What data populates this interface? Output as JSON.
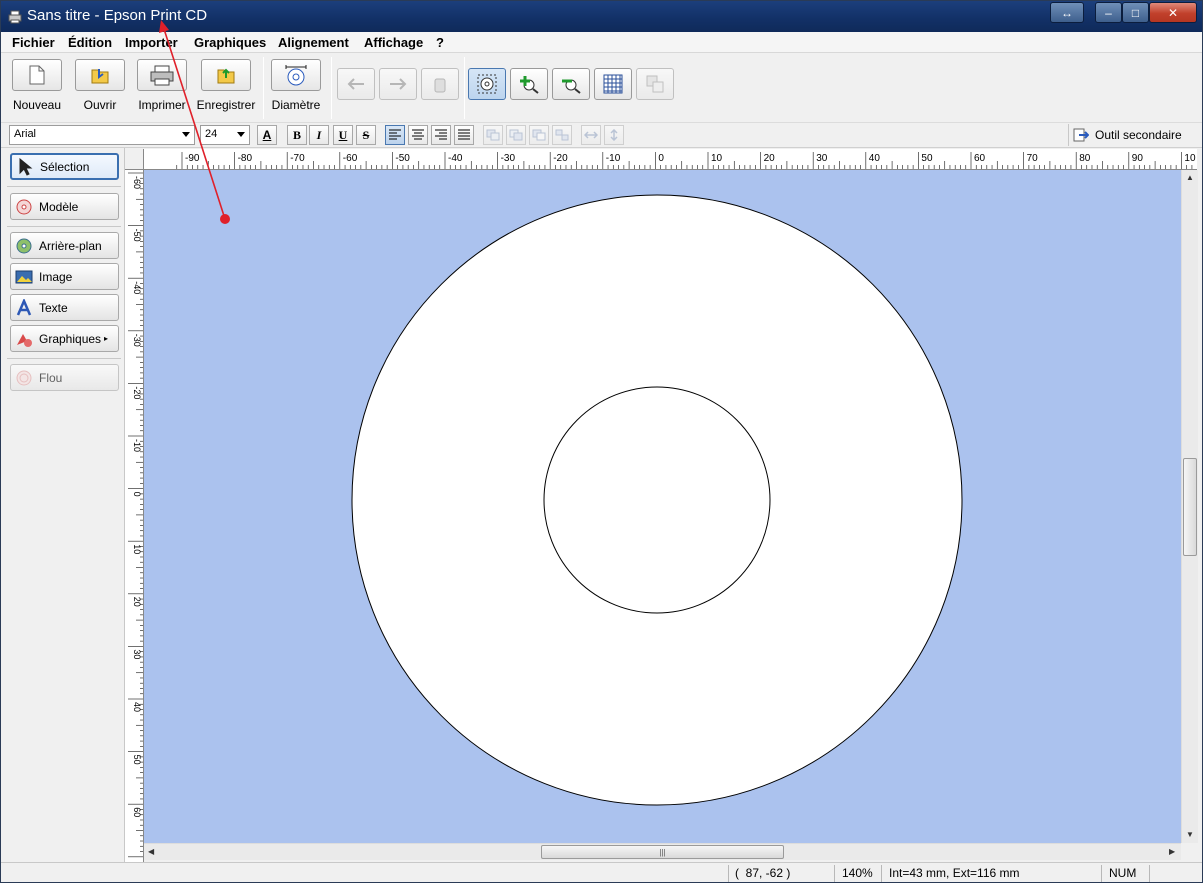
{
  "window": {
    "title": "Sans titre - Epson Print CD",
    "controls": {
      "restore_glyph": "↔",
      "minimize_glyph": "–",
      "maximize_glyph": "□",
      "close_glyph": "✕"
    }
  },
  "menu": {
    "items": [
      "Fichier",
      "Édition",
      "Importer",
      "Graphiques",
      "Alignement",
      "Affichage",
      "?"
    ]
  },
  "toolbar": {
    "new_label": "Nouveau",
    "open_label": "Ouvrir",
    "print_label": "Imprimer",
    "save_label": "Enregistrer",
    "diameter_label": "Diamètre"
  },
  "format": {
    "font": "Arial",
    "size": "24",
    "bold": "B",
    "italic": "I",
    "underline": "U",
    "strike": "S",
    "secondary_tool_label": "Outil secondaire"
  },
  "tools": {
    "selection": "Sélection",
    "model": "Modèle",
    "background": "Arrière-plan",
    "image": "Image",
    "text": "Texte",
    "graphics": "Graphiques",
    "blur": "Flou"
  },
  "ruler": {
    "h_labels": [
      "-90",
      "-80",
      "-70",
      "-60",
      "-50",
      "-40",
      "-30",
      "-20",
      "-10",
      "0",
      "10",
      "20",
      "30",
      "40",
      "50",
      "60",
      "70",
      "80",
      "90",
      "10"
    ],
    "v_labels": [
      "-60",
      "-50",
      "-40",
      "-30",
      "-20",
      "-10",
      "0",
      "10",
      "20",
      "30",
      "40",
      "50",
      "60"
    ]
  },
  "status": {
    "coords": "(  87, -62 )",
    "zoom": "140%",
    "diameters": "Int=43 mm, Ext=116 mm",
    "num": "NUM"
  },
  "colors": {
    "canvas_bg": "#abc2ee",
    "titlebar": "#123066",
    "annotation": "#e0202a"
  }
}
